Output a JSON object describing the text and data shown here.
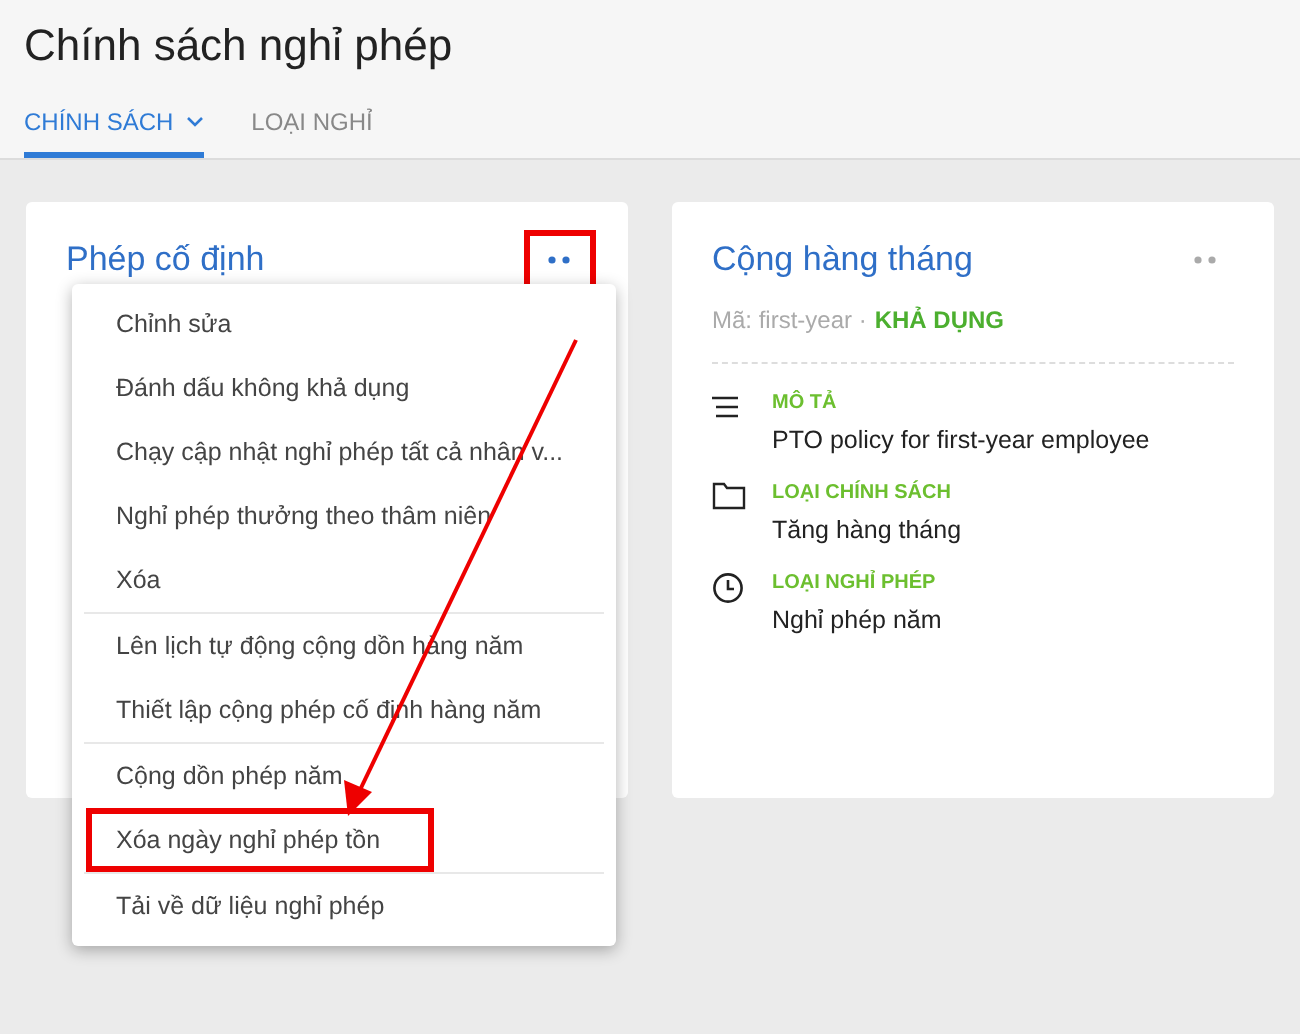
{
  "page": {
    "title": "Chính sách nghỉ phép"
  },
  "tabs": [
    {
      "label": "CHÍNH SÁCH",
      "selected": true,
      "dropdown": true
    },
    {
      "label": "LOẠI NGHỈ",
      "selected": false,
      "dropdown": false
    }
  ],
  "cards": [
    {
      "title": "Phép cố định",
      "more_annotated": true
    },
    {
      "title": "Cộng hàng tháng",
      "more_annotated": false,
      "code": "Mã: first-year ·",
      "status": "KHẢ DỤNG",
      "fields": [
        {
          "kind": "description",
          "label": "MÔ TẢ",
          "value": "PTO policy for first-year employee"
        },
        {
          "kind": "folder",
          "label": "LOẠI CHÍNH SÁCH",
          "value": "Tăng hàng tháng"
        },
        {
          "kind": "clock",
          "label": "LOẠI NGHỈ PHÉP",
          "value": "Nghỉ phép năm"
        }
      ]
    }
  ],
  "menu": {
    "sections": [
      [
        {
          "label": "Chỉnh sửa",
          "annotated": false
        },
        {
          "label": "Đánh dấu không khả dụng",
          "annotated": false
        },
        {
          "label": "Chạy cập nhật nghỉ phép tất cả nhân v...",
          "annotated": false
        },
        {
          "label": "Nghỉ phép thưởng theo thâm niên",
          "annotated": false
        },
        {
          "label": "Xóa",
          "annotated": false
        }
      ],
      [
        {
          "label": "Lên lịch tự động cộng dồn hàng năm",
          "annotated": false
        },
        {
          "label": "Thiết lập cộng phép cố định hàng năm",
          "annotated": false
        }
      ],
      [
        {
          "label": "Cộng dồn phép năm",
          "annotated": false
        },
        {
          "label": "Xóa ngày nghỉ phép tồn",
          "annotated": true
        }
      ],
      [
        {
          "label": "Tải về dữ liệu nghỉ phép",
          "annotated": false
        }
      ]
    ]
  }
}
